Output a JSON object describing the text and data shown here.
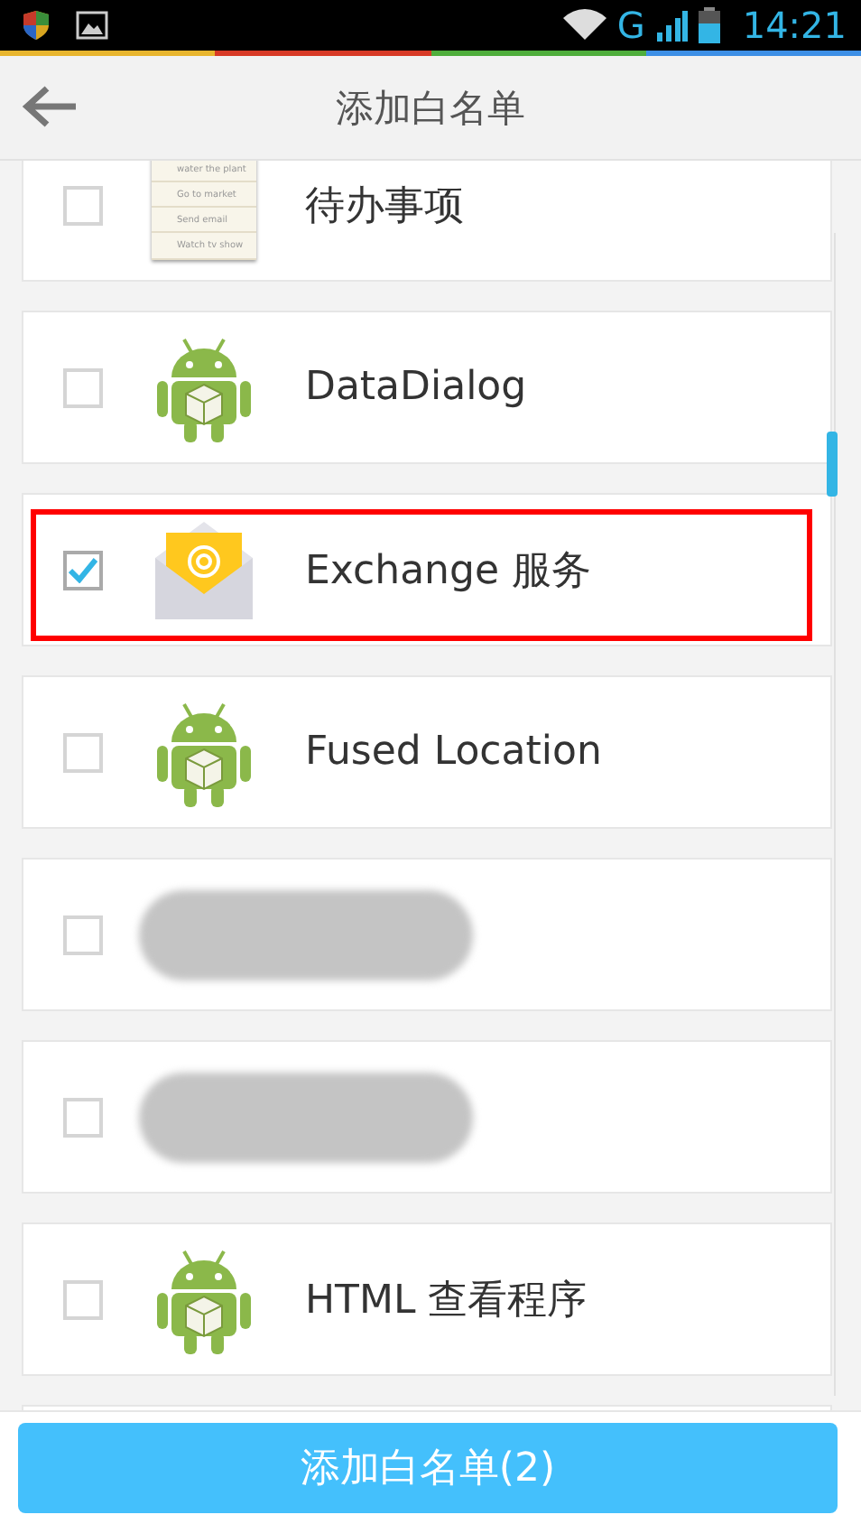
{
  "status_bar": {
    "network": "G",
    "time": "14:21"
  },
  "header": {
    "title": "添加白名单"
  },
  "apps": [
    {
      "kind": "todo",
      "name": "待办事项",
      "checked": false,
      "highlighted": false
    },
    {
      "kind": "android",
      "name": "DataDialog",
      "checked": false,
      "highlighted": false
    },
    {
      "kind": "email",
      "name": "Exchange 服务",
      "checked": true,
      "highlighted": true
    },
    {
      "kind": "android",
      "name": "Fused Location",
      "checked": false,
      "highlighted": false
    },
    {
      "kind": "redacted",
      "checked": false,
      "highlighted": false
    },
    {
      "kind": "redacted",
      "checked": false,
      "highlighted": false
    },
    {
      "kind": "android",
      "name": "HTML 查看程序",
      "checked": false,
      "highlighted": false
    }
  ],
  "todo_icon_lines": [
    "water the plant",
    "Go to market",
    "Send email",
    "Watch tv show"
  ],
  "add_button": {
    "label": "添加白名单(2)"
  }
}
